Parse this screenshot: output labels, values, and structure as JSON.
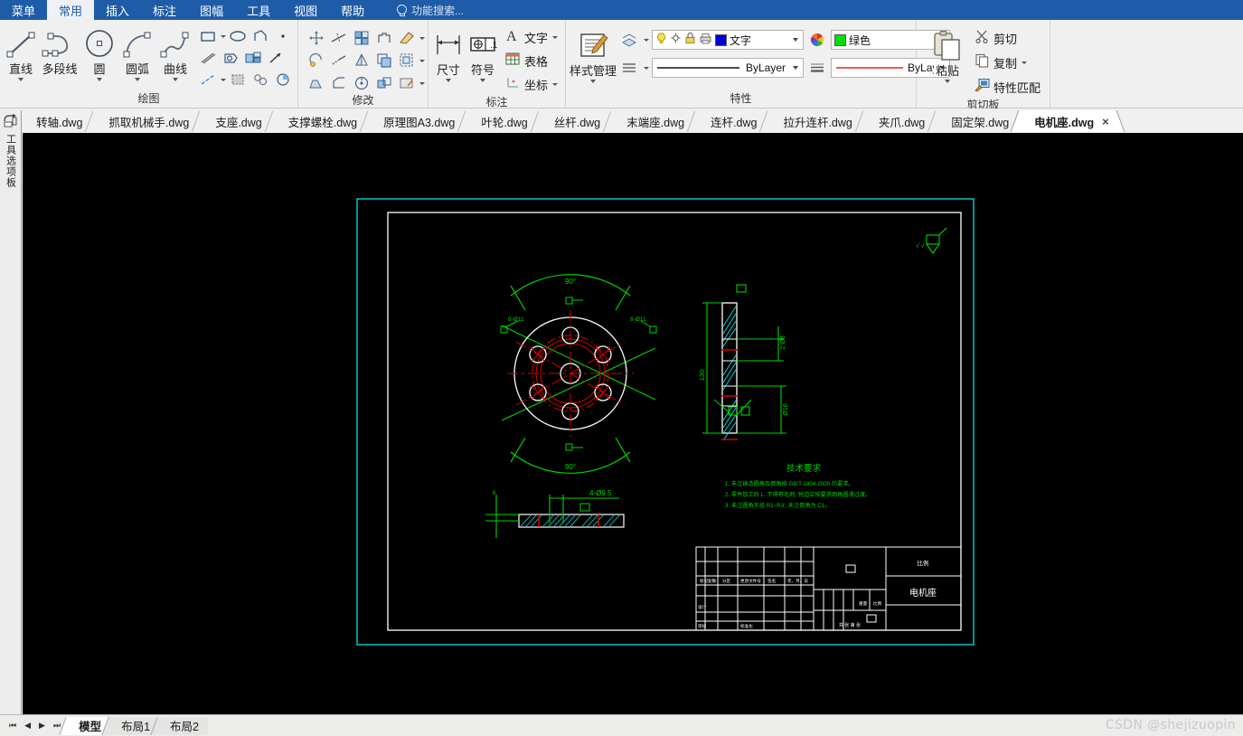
{
  "menu": {
    "items": [
      {
        "label": "菜单",
        "active": false
      },
      {
        "label": "常用",
        "active": true
      },
      {
        "label": "插入",
        "active": false
      },
      {
        "label": "标注",
        "active": false
      },
      {
        "label": "图幅",
        "active": false
      },
      {
        "label": "工具",
        "active": false
      },
      {
        "label": "视图",
        "active": false
      },
      {
        "label": "帮助",
        "active": false
      }
    ],
    "search_placeholder": "功能搜索..."
  },
  "ribbon": {
    "draw": {
      "title": "绘图",
      "buttons": [
        {
          "label": "直线",
          "icon": "line-icon"
        },
        {
          "label": "多段线",
          "icon": "polyline-icon"
        },
        {
          "label": "圆",
          "icon": "circle-icon"
        },
        {
          "label": "圆弧",
          "icon": "arc-icon"
        },
        {
          "label": "曲线",
          "icon": "spline-icon"
        }
      ],
      "small_icons": [
        "rectangle-icon",
        "ellipse-icon",
        "polygon-icon",
        "point-icon",
        "double-line-icon",
        "region-icon",
        "block-icon",
        "ray-icon",
        "construction-line-icon",
        "boundary-hatch-icon",
        "revision-cloud-icon",
        "gradient-icon"
      ]
    },
    "modify": {
      "title": "修改",
      "small_icons": [
        "move-icon",
        "trim-icon",
        "array-icon",
        "copy-object-icon",
        "erase-icon",
        "rotate-icon",
        "extend-icon",
        "mirror-icon",
        "offset-icon",
        "scale-icon",
        "stretch-icon",
        "chamfer-icon",
        "fillet-icon",
        "explode-icon",
        "edit-hatch-icon"
      ]
    },
    "annotate": {
      "title": "标注",
      "buttons": [
        {
          "label": "尺寸",
          "icon": "dimension-icon"
        },
        {
          "label": "符号",
          "icon": "symbol-icon"
        }
      ],
      "rows": [
        {
          "label": "文字",
          "icon": "text-icon"
        },
        {
          "label": "表格",
          "icon": "table-icon"
        },
        {
          "label": "坐标",
          "icon": "coordinate-icon"
        }
      ]
    },
    "properties": {
      "title": "特性",
      "style_manager": {
        "label": "样式管理",
        "icon": "style-manager-icon"
      },
      "layer_combo": {
        "value": "文字",
        "icon": "layer-icon"
      },
      "color_combo": {
        "value": "绿色",
        "color": "#00e000",
        "icon": "color-wheel-icon"
      },
      "linetype_combo": {
        "value": "ByLayer",
        "icon": "linetype-icon"
      },
      "lineweight_combo": {
        "value": "ByLay",
        "color": "#cc0000",
        "icon": "lineweight-icon"
      }
    },
    "clipboard": {
      "title": "剪切板",
      "paste": {
        "label": "粘贴",
        "icon": "paste-icon"
      },
      "rows": [
        {
          "label": "剪切",
          "icon": "cut-icon"
        },
        {
          "label": "复制",
          "icon": "copy-icon"
        },
        {
          "label": "特性匹配",
          "icon": "match-properties-icon"
        }
      ]
    }
  },
  "palette": {
    "label": "工具选项板",
    "icon": "tool-palette-icon"
  },
  "document_tabs": [
    {
      "label": "转轴.dwg",
      "active": false
    },
    {
      "label": "抓取机械手.dwg",
      "active": false
    },
    {
      "label": "支座.dwg",
      "active": false
    },
    {
      "label": "支撑螺栓.dwg",
      "active": false
    },
    {
      "label": "原理图A3.dwg",
      "active": false
    },
    {
      "label": "叶轮.dwg",
      "active": false
    },
    {
      "label": "丝杆.dwg",
      "active": false
    },
    {
      "label": "末端座.dwg",
      "active": false
    },
    {
      "label": "连杆.dwg",
      "active": false
    },
    {
      "label": "拉升连杆.dwg",
      "active": false
    },
    {
      "label": "夹爪.dwg",
      "active": false
    },
    {
      "label": "固定架.dwg",
      "active": false
    },
    {
      "label": "电机座.dwg",
      "active": true
    }
  ],
  "tab_close_label": "×",
  "drawing": {
    "front_view": {
      "angle_top": "90°",
      "angle_bottom": "90°",
      "leader_left": "8-Ø11",
      "leader_right": "8-Ø11"
    },
    "section_view": {
      "dim_height": "130",
      "dim_top": "2-Ø8",
      "dim_mid": "Ø16"
    },
    "detail_view": {
      "dim_label": "4-Ø9.5"
    },
    "tech_notes": {
      "title": "技术要求",
      "lines": [
        "1. 未注铸造圆角及倒角按 GB/T 1804-2000 的要求。",
        "2. 零件加工后 L. 不得有毛刺, 锐边应按要求倒角圆滑过渡。",
        "3. 未注圆角半径 R1~R3', 未注倒角为 C1。"
      ]
    },
    "title_block": {
      "part_name": "电机座",
      "scale_label": "比例",
      "row_headers": [
        "标记",
        "处数",
        "分区",
        "更改文件号",
        "签名",
        "年、月、日"
      ],
      "footer_left": [
        "设计",
        "审核"
      ],
      "footer_cells": [
        "标准化",
        "工艺"
      ],
      "stage_row": [
        "阶段标记",
        "重量",
        "比例"
      ],
      "sheet_row": [
        "共 张 第 张"
      ]
    }
  },
  "layout_tabs": [
    {
      "label": "模型",
      "active": true
    },
    {
      "label": "布局1",
      "active": false
    },
    {
      "label": "布局2",
      "active": false
    }
  ],
  "nav_buttons": [
    "first-layout",
    "prev-layout",
    "next-layout",
    "last-layout"
  ],
  "watermark": "CSDN @shejizuopin"
}
